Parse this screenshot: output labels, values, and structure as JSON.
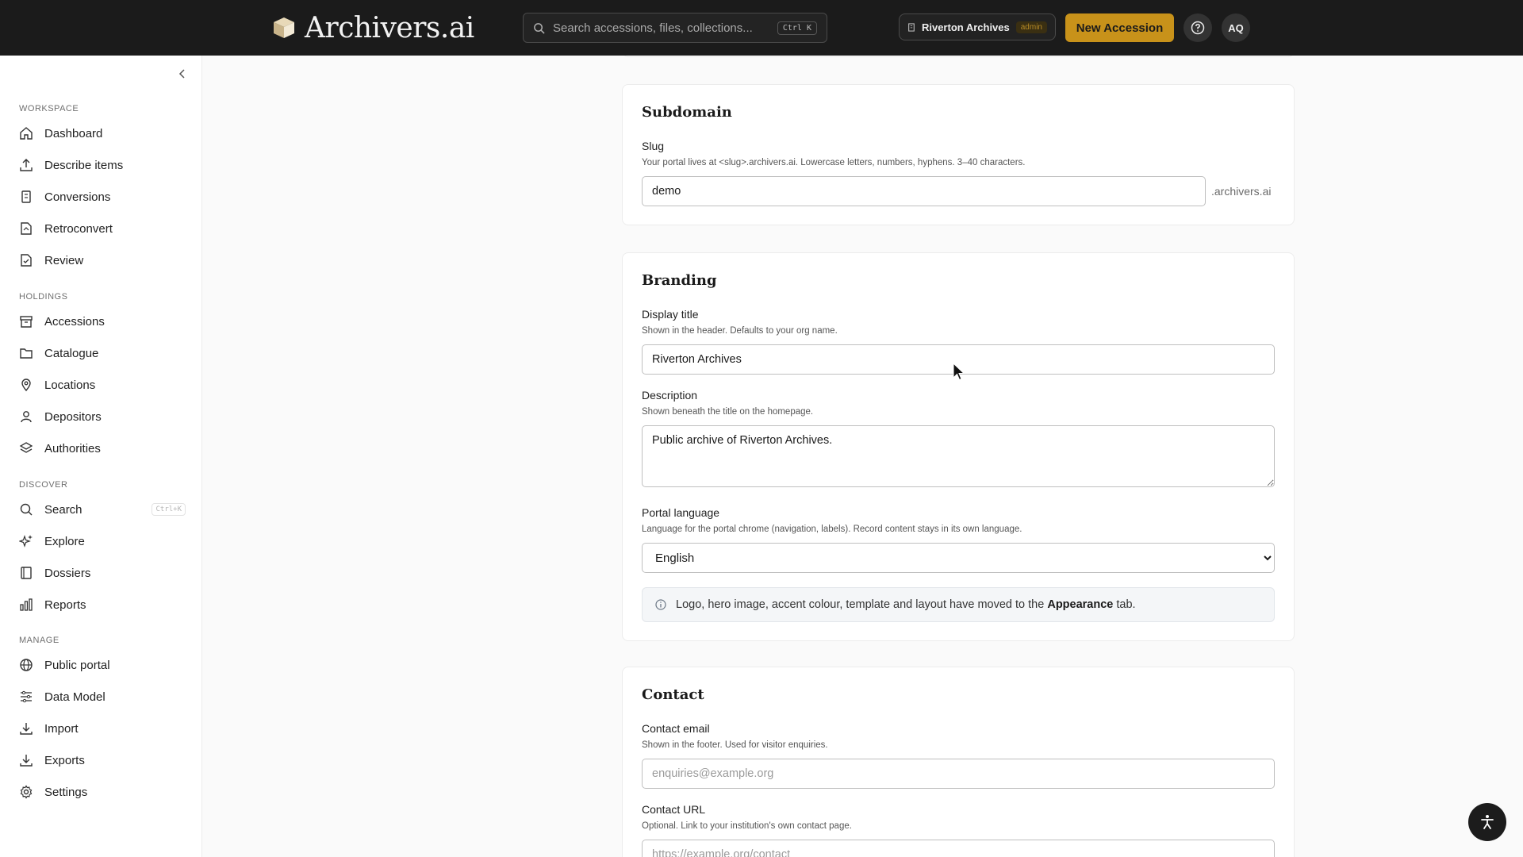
{
  "header": {
    "app_name": "Archivers.ai",
    "search_placeholder": "Search accessions, files, collections...",
    "search_shortcut": "Ctrl K",
    "org_name": "Riverton Archives",
    "role_badge": "admin",
    "new_accession_label": "New Accession",
    "help_icon": "help-circle-icon",
    "avatar_initials": "AQ",
    "accent_color": "#c8921a"
  },
  "sidebar": {
    "collapse_icon": "chevron-left-icon",
    "sections": [
      {
        "label": "WORKSPACE",
        "items": [
          {
            "label": "Dashboard",
            "icon": "home-icon"
          },
          {
            "label": "Describe items",
            "icon": "upload-icon"
          },
          {
            "label": "Conversions",
            "icon": "convert-icon"
          },
          {
            "label": "Retroconvert",
            "icon": "file-convert-icon"
          },
          {
            "label": "Review",
            "icon": "file-check-icon"
          }
        ]
      },
      {
        "label": "HOLDINGS",
        "items": [
          {
            "label": "Accessions",
            "icon": "archive-icon"
          },
          {
            "label": "Catalogue",
            "icon": "folder-icon"
          },
          {
            "label": "Locations",
            "icon": "map-pin-icon"
          },
          {
            "label": "Depositors",
            "icon": "user-icon"
          },
          {
            "label": "Authorities",
            "icon": "stack-icon"
          }
        ]
      },
      {
        "label": "DISCOVER",
        "items": [
          {
            "label": "Search",
            "icon": "search-icon",
            "shortcut": "Ctrl+K"
          },
          {
            "label": "Explore",
            "icon": "sparkles-icon"
          },
          {
            "label": "Dossiers",
            "icon": "book-icon"
          },
          {
            "label": "Reports",
            "icon": "bar-chart-icon"
          }
        ]
      },
      {
        "label": "MANAGE",
        "items": [
          {
            "label": "Public portal",
            "icon": "globe-icon"
          },
          {
            "label": "Data Model",
            "icon": "sliders-icon"
          },
          {
            "label": "Import",
            "icon": "download-icon"
          },
          {
            "label": "Exports",
            "icon": "download-icon"
          },
          {
            "label": "Settings",
            "icon": "gear-icon"
          }
        ]
      }
    ]
  },
  "subdomain": {
    "title": "Subdomain",
    "slug_label": "Slug",
    "slug_help": "Your portal lives at <slug>.archivers.ai. Lowercase letters, numbers, hyphens. 3–40 characters.",
    "slug_value": "demo",
    "slug_suffix": ".archivers.ai"
  },
  "branding": {
    "title": "Branding",
    "display_title_label": "Display title",
    "display_title_help": "Shown in the header. Defaults to your org name.",
    "display_title_value": "Riverton Archives",
    "description_label": "Description",
    "description_help": "Shown beneath the title on the homepage.",
    "description_value": "Public archive of Riverton Archives.",
    "language_label": "Portal language",
    "language_help": "Language for the portal chrome (navigation, labels). Record content stays in its own language.",
    "language_value": "English",
    "info_prefix": "Logo, hero image, accent colour, template and layout have moved to the",
    "info_link": "Appearance",
    "info_suffix": "tab."
  },
  "contact": {
    "title": "Contact",
    "email_label": "Contact email",
    "email_help": "Shown in the footer. Used for visitor enquiries.",
    "email_placeholder": "enquiries@example.org",
    "url_label": "Contact URL",
    "url_help": "Optional. Link to your institution's own contact page.",
    "url_placeholder": "https://example.org/contact"
  },
  "accessibility_icon": "accessibility-icon"
}
